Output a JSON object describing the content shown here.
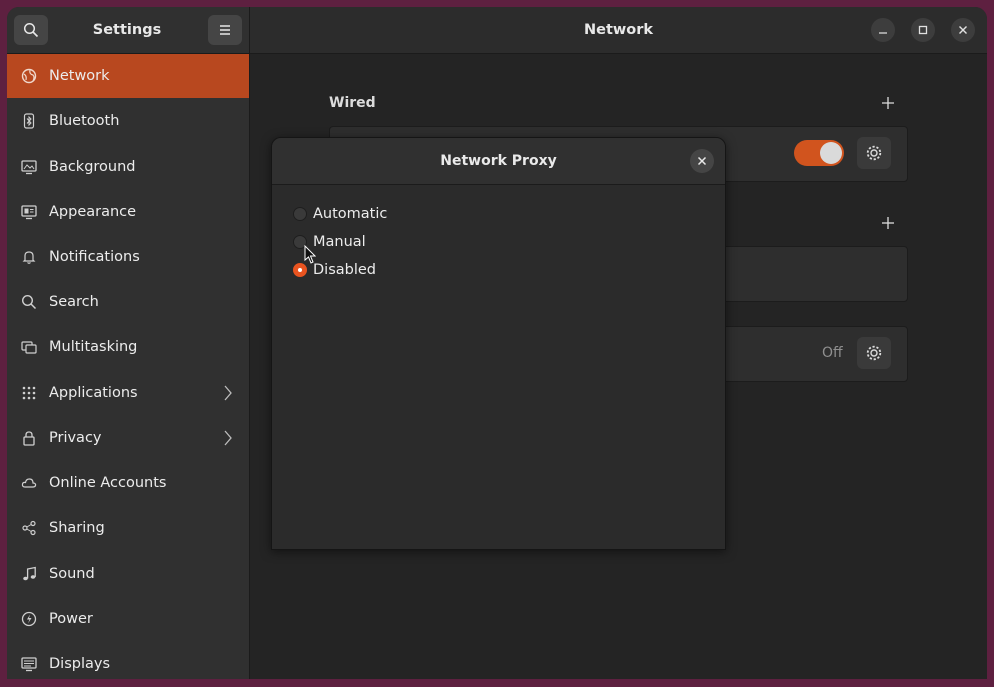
{
  "sidebar": {
    "title": "Settings",
    "items": [
      {
        "label": "Network",
        "icon": "network-icon",
        "active": true
      },
      {
        "label": "Bluetooth",
        "icon": "bluetooth-icon"
      },
      {
        "label": "Background",
        "icon": "background-icon"
      },
      {
        "label": "Appearance",
        "icon": "appearance-icon"
      },
      {
        "label": "Notifications",
        "icon": "bell-icon"
      },
      {
        "label": "Search",
        "icon": "search-icon"
      },
      {
        "label": "Multitasking",
        "icon": "multitasking-icon"
      },
      {
        "label": "Applications",
        "icon": "grid-icon",
        "submenu": true
      },
      {
        "label": "Privacy",
        "icon": "lock-icon",
        "submenu": true
      },
      {
        "label": "Online Accounts",
        "icon": "cloud-icon"
      },
      {
        "label": "Sharing",
        "icon": "share-icon"
      },
      {
        "label": "Sound",
        "icon": "music-note-icon"
      },
      {
        "label": "Power",
        "icon": "power-icon"
      },
      {
        "label": "Displays",
        "icon": "display-icon"
      }
    ]
  },
  "header": {
    "title": "Network"
  },
  "content": {
    "wired_label": "Wired",
    "vpn_off_label": "Off"
  },
  "dialog": {
    "title": "Network Proxy",
    "options": [
      {
        "label": "Automatic",
        "selected": false
      },
      {
        "label": "Manual",
        "selected": false
      },
      {
        "label": "Disabled",
        "selected": true
      }
    ]
  },
  "colors": {
    "accent": "#e95420",
    "active_item": "#b8481f",
    "window_bg": "#242424",
    "sidebar_bg": "#303030"
  }
}
